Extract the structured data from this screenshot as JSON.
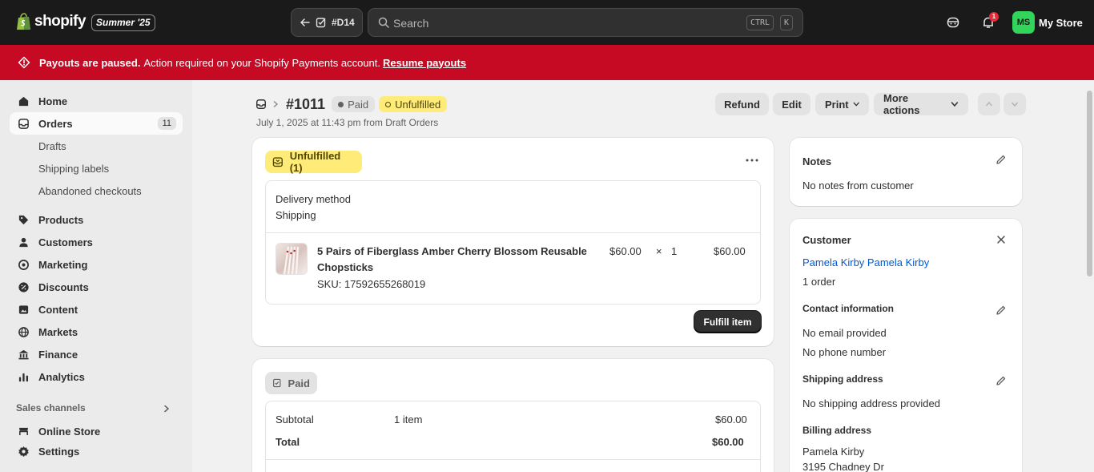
{
  "topbar": {
    "logo_text": "shopify",
    "edition": "Summer '25",
    "back_label": "#D14",
    "search_placeholder": "Search",
    "shortcut_1": "CTRL",
    "shortcut_2": "K",
    "notification_count": "1",
    "store_initials": "MS",
    "store_name": "My Store"
  },
  "banner": {
    "bold": "Payouts are paused.",
    "text": "Action required on your Shopify Payments account.",
    "link": "Resume payouts"
  },
  "sidebar": {
    "home": "Home",
    "orders": "Orders",
    "orders_count": "11",
    "drafts": "Drafts",
    "shipping_labels": "Shipping labels",
    "abandoned_checkouts": "Abandoned checkouts",
    "products": "Products",
    "customers": "Customers",
    "marketing": "Marketing",
    "discounts": "Discounts",
    "content": "Content",
    "markets": "Markets",
    "finance": "Finance",
    "analytics": "Analytics",
    "sales_channels": "Sales channels",
    "online_store": "Online Store",
    "settings": "Settings"
  },
  "header": {
    "order_number": "#1011",
    "paid_badge": "Paid",
    "fulfillment_badge": "Unfulfilled",
    "subtitle": "July 1, 2025 at 11:43 pm from Draft Orders",
    "refund": "Refund",
    "edit": "Edit",
    "print": "Print",
    "more_actions": "More actions"
  },
  "fulfillment_card": {
    "status": "Unfulfilled (1)",
    "delivery_label": "Delivery method",
    "delivery_value": "Shipping",
    "item_title_line1": "5 Pairs of Fiberglass Amber Cherry Blossom Reusable",
    "item_title_line2": "Chopsticks",
    "sku": "SKU: 17592655268019",
    "unit_price": "$60.00",
    "times": "×",
    "quantity": "1",
    "line_total": "$60.00",
    "fulfill_button": "Fulfill item"
  },
  "payment_card": {
    "status": "Paid",
    "subtotal_label": "Subtotal",
    "subtotal_items": "1 item",
    "subtotal_value": "$60.00",
    "total_label": "Total",
    "total_value": "$60.00"
  },
  "notes_card": {
    "title": "Notes",
    "text": "No notes from customer"
  },
  "customer_card": {
    "title": "Customer",
    "name_link": "Pamela Kirby Pamela Kirby",
    "orders": "1 order",
    "contact_title": "Contact information",
    "no_email": "No email provided",
    "no_phone": "No phone number",
    "shipping_title": "Shipping address",
    "no_shipping": "No shipping address provided",
    "billing_title": "Billing address",
    "billing_name": "Pamela Kirby",
    "billing_street": "3195 Chadney Dr"
  },
  "colors": {
    "topbar": "#1a1a1a",
    "banner": "#c70a24",
    "unfulfilled": "#ffeb78",
    "link": "#005bd3",
    "store_avatar": "#33d45b"
  }
}
